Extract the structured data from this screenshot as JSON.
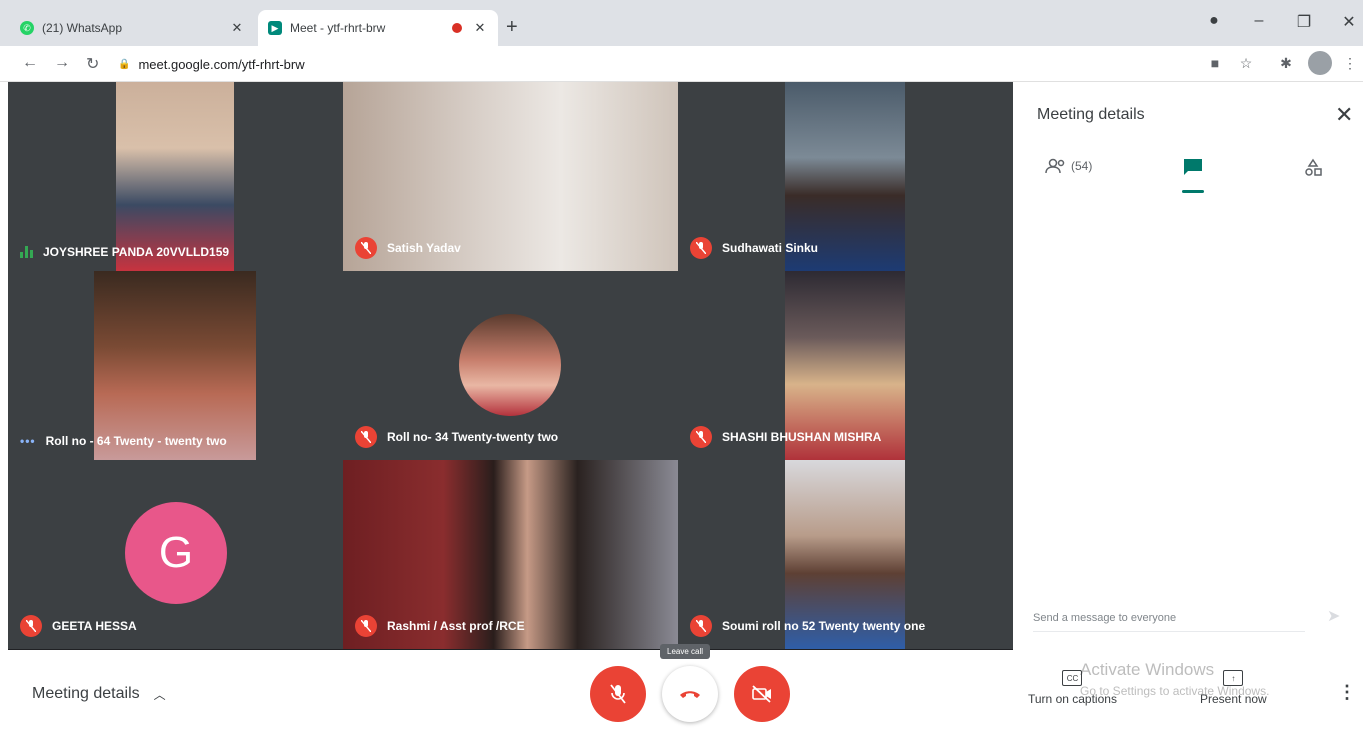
{
  "browser": {
    "tabs": [
      {
        "title": "(21) WhatsApp",
        "favicon": "whatsapp-icon",
        "active": false
      },
      {
        "title": "Meet - ytf-rhrt-brw",
        "favicon": "google-meet-icon",
        "active": true,
        "recording": true
      }
    ],
    "url": "meet.google.com/ytf-rhrt-brw"
  },
  "participants": [
    {
      "name": "JOYSHREE PANDA 20VVLLD159",
      "status": "speaking",
      "video": "camera"
    },
    {
      "name": "Satish Yadav",
      "status": "muted",
      "video": "camera"
    },
    {
      "name": "Sudhawati Sinku",
      "status": "muted",
      "video": "camera"
    },
    {
      "name": "Roll no - 64 Twenty - twenty two",
      "status": "idle",
      "video": "camera"
    },
    {
      "name": "Roll no- 34 Twenty-twenty two",
      "status": "muted",
      "video": "profile-photo"
    },
    {
      "name": "SHASHI BHUSHAN MISHRA",
      "status": "muted",
      "video": "camera"
    },
    {
      "name": "GEETA HESSA",
      "status": "muted",
      "video": "initial",
      "initial": "G"
    },
    {
      "name": "Rashmi / Asst prof /RCE",
      "status": "muted",
      "video": "camera"
    },
    {
      "name": "Soumi roll no 52 Twenty twenty one",
      "status": "muted",
      "video": "camera"
    }
  ],
  "side_panel": {
    "title": "Meeting details",
    "people_count": "(54)",
    "chat_placeholder": "Send a message to everyone"
  },
  "bottom_bar": {
    "meeting_details_label": "Meeting details",
    "leave_tooltip": "Leave call",
    "captions_label": "Turn on captions",
    "present_label": "Present now"
  },
  "watermark": {
    "line1": "Activate Windows",
    "line2": "Go to Settings to activate Windows."
  },
  "colors": {
    "meet_green": "#00796b",
    "danger_red": "#ea4335",
    "grid_bg": "#202124",
    "avatar_pink": "#e8578a"
  }
}
